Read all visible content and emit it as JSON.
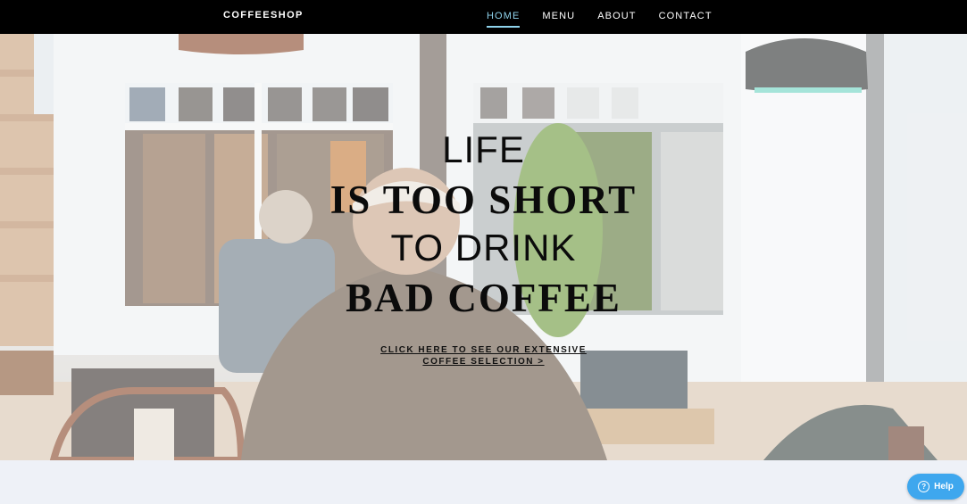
{
  "header": {
    "brand": "COFFEESHOP",
    "nav": [
      {
        "label": "HOME",
        "active": true
      },
      {
        "label": "MENU",
        "active": false
      },
      {
        "label": "ABOUT",
        "active": false
      },
      {
        "label": "CONTACT",
        "active": false
      }
    ],
    "active_color": "#8fd3ec"
  },
  "hero": {
    "line1": "LIFE",
    "line2": "IS TOO SHORT",
    "line3": "TO DRINK",
    "line4": "BAD COFFEE",
    "cta_line1": "CLICK HERE TO SEE OUR EXTENSIVE",
    "cta_line2": "COFFEE SELECTION >",
    "background_image": "cafe-interior-photo"
  },
  "help": {
    "label": "Help",
    "icon": "question-circle-icon",
    "color": "#3ea7ee"
  }
}
